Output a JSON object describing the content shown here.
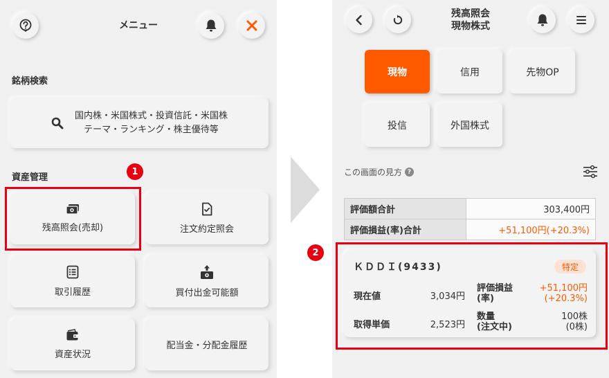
{
  "left_menu": {
    "title": "メニュー",
    "section_search": "銘柄検索",
    "search_line1": "国内株・米国株式・投資信託・米国株",
    "search_line2": "テーマ・ランキング・株主優待等",
    "section_assets": "資産管理",
    "items": [
      {
        "label": "残高照会(売却)",
        "icon": "banknote-icon"
      },
      {
        "label": "注文約定照会",
        "icon": "document-check-icon"
      },
      {
        "label": "取引履歴",
        "icon": "list-icon"
      },
      {
        "label": "買付出金可能額",
        "icon": "money-up-icon"
      },
      {
        "label": "資産状況",
        "icon": "wallet-icon"
      },
      {
        "label": "配当金・分配金履歴",
        "icon": ""
      }
    ],
    "badge": "1"
  },
  "right_screen": {
    "title_line1": "残高照会",
    "title_line2": "現物株式",
    "tabs": [
      "現物",
      "信用",
      "先物OP",
      "投信",
      "外国株式"
    ],
    "active_tab": "現物",
    "howto": "この画面の見方",
    "help_glyph": "?",
    "summary": [
      {
        "label": "評価額合計",
        "value": "303,400円"
      },
      {
        "label": "評価損益(率)合計",
        "value": "+51,100円(+20.3%)"
      }
    ],
    "badge": "2",
    "stock": {
      "name": "ＫＤＤＩ(9433)",
      "tag": "特定",
      "current_label": "現在値",
      "current_value": "3,034円",
      "pl_label_1": "評価損益",
      "pl_label_2": "(率)",
      "pl_value_1": "+51,100円",
      "pl_value_2": "(+20.3%)",
      "cost_label": "取得単価",
      "cost_value": "2,523円",
      "qty_label_1": "数量",
      "qty_label_2": "(注文中)",
      "qty_value_1": "100株",
      "qty_value_2": "(0株)"
    }
  },
  "colors": {
    "accent": "#ff5a00",
    "highlight": "#e60012",
    "panel": "#f0f0f0"
  }
}
